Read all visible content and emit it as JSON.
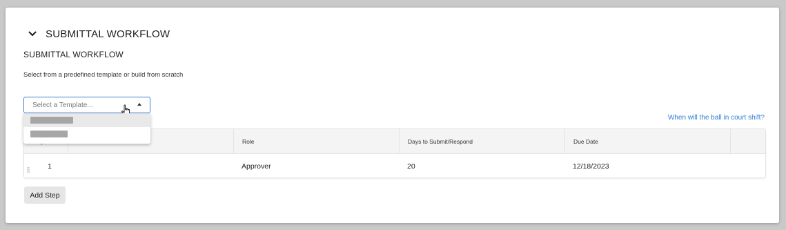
{
  "section": {
    "header_title": "SUBMITTAL WORKFLOW",
    "subtitle": "SUBMITTAL WORKFLOW",
    "helper_text": "Select from a predefined template or build from scratch"
  },
  "template_select": {
    "placeholder": "Select a Template...",
    "options": [
      "",
      ""
    ]
  },
  "ball_in_court_link": "When will the ball in court shift?",
  "table": {
    "columns": [
      "Step",
      "Name",
      "Role",
      "Days to Submit/Respond",
      "Due Date",
      ""
    ],
    "rows": [
      {
        "step": "1",
        "name": "",
        "role": "Approver",
        "days": "20",
        "due_date": "12/18/2023"
      }
    ]
  },
  "add_step_label": "Add Step",
  "colors": {
    "accent": "#3a7bd5",
    "link": "#2f7dd6",
    "button_bg": "#e6e6e6"
  }
}
